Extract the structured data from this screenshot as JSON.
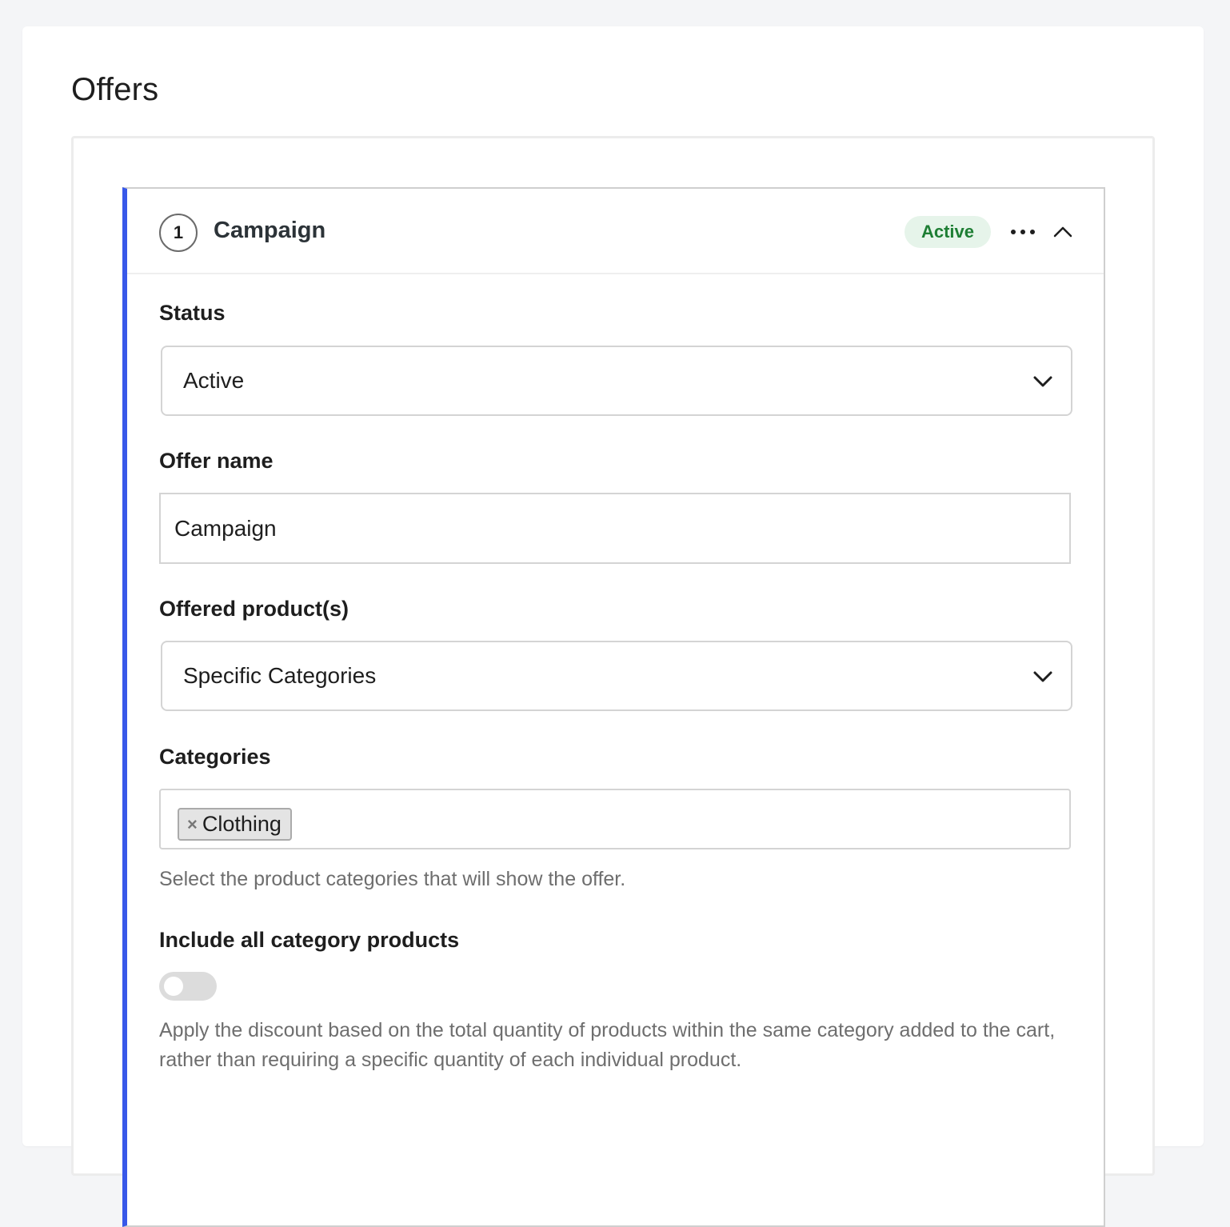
{
  "page": {
    "title": "Offers"
  },
  "offer": {
    "number": "1",
    "title": "Campaign",
    "status_badge": "Active",
    "more_label": "•••",
    "fields": {
      "status": {
        "label": "Status",
        "value": "Active"
      },
      "offer_name": {
        "label": "Offer name",
        "value": "Campaign"
      },
      "offered_products": {
        "label": "Offered product(s)",
        "value": "Specific Categories"
      },
      "categories": {
        "label": "Categories",
        "selected": [
          {
            "label": "Clothing",
            "remove": "×"
          }
        ],
        "help": "Select the product categories that will show the offer."
      },
      "include_all": {
        "label": "Include all category products",
        "enabled": false,
        "help": "Apply the discount based on the total quantity of products within the same category added to the cart, rather than requiring a specific quantity of each individual product."
      }
    }
  },
  "colors": {
    "accent": "#3858e9",
    "badge_bg": "#e6f4ea",
    "badge_text": "#1e7e34"
  },
  "icons": {
    "step": "number-circle-icon",
    "more": "ellipsis-icon",
    "collapse": "chevron-up-icon",
    "select": "chevron-down-icon",
    "chip_remove": "close-icon"
  }
}
